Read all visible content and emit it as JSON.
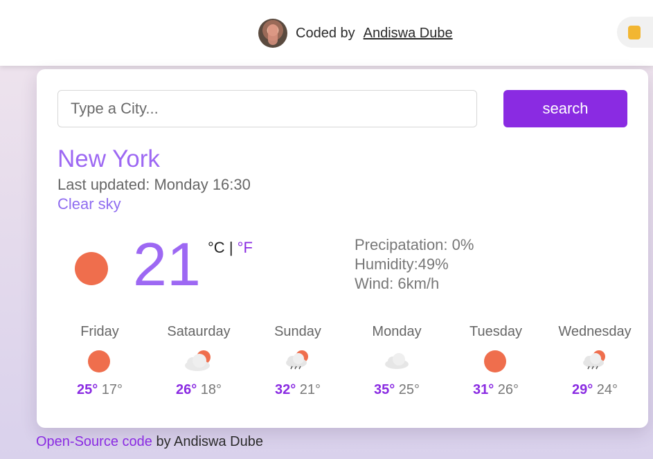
{
  "header": {
    "credit_prefix": "Coded by",
    "author_link": "Andiswa Dube"
  },
  "search": {
    "placeholder": "Type a City...",
    "button_label": "search"
  },
  "weather": {
    "city": "New York",
    "updated": "Last updated: Monday 16:30",
    "description": "Clear sky",
    "temperature": "21",
    "unit_c": "°C",
    "unit_separator": "|",
    "unit_f": "°F",
    "details": {
      "precipitation": "Precipatation: 0%",
      "humidity": "Humidity:49%",
      "wind": "Wind: 6km/h"
    },
    "main_icon": "sun-icon"
  },
  "forecast": [
    {
      "day": "Friday",
      "icon": "sun-icon",
      "max": "25°",
      "min": "17°"
    },
    {
      "day": "Sataurday",
      "icon": "cloud-sun-icon",
      "max": "26°",
      "min": "18°"
    },
    {
      "day": "Sunday",
      "icon": "rain-sun-icon",
      "max": "32°",
      "min": "21°"
    },
    {
      "day": "Monday",
      "icon": "cloud-icon",
      "max": "35°",
      "min": "25°"
    },
    {
      "day": "Tuesday",
      "icon": "sun-icon",
      "max": "31°",
      "min": "26°"
    },
    {
      "day": "Wednesday",
      "icon": "rain-sun-icon",
      "max": "29°",
      "min": "24°"
    }
  ],
  "footer": {
    "link_text": "Open-Source code",
    "suffix": "by Andiswa Dube"
  },
  "colors": {
    "accent": "#8a2be2",
    "city": "#9d68f3",
    "sun": "#ef6e4d"
  }
}
